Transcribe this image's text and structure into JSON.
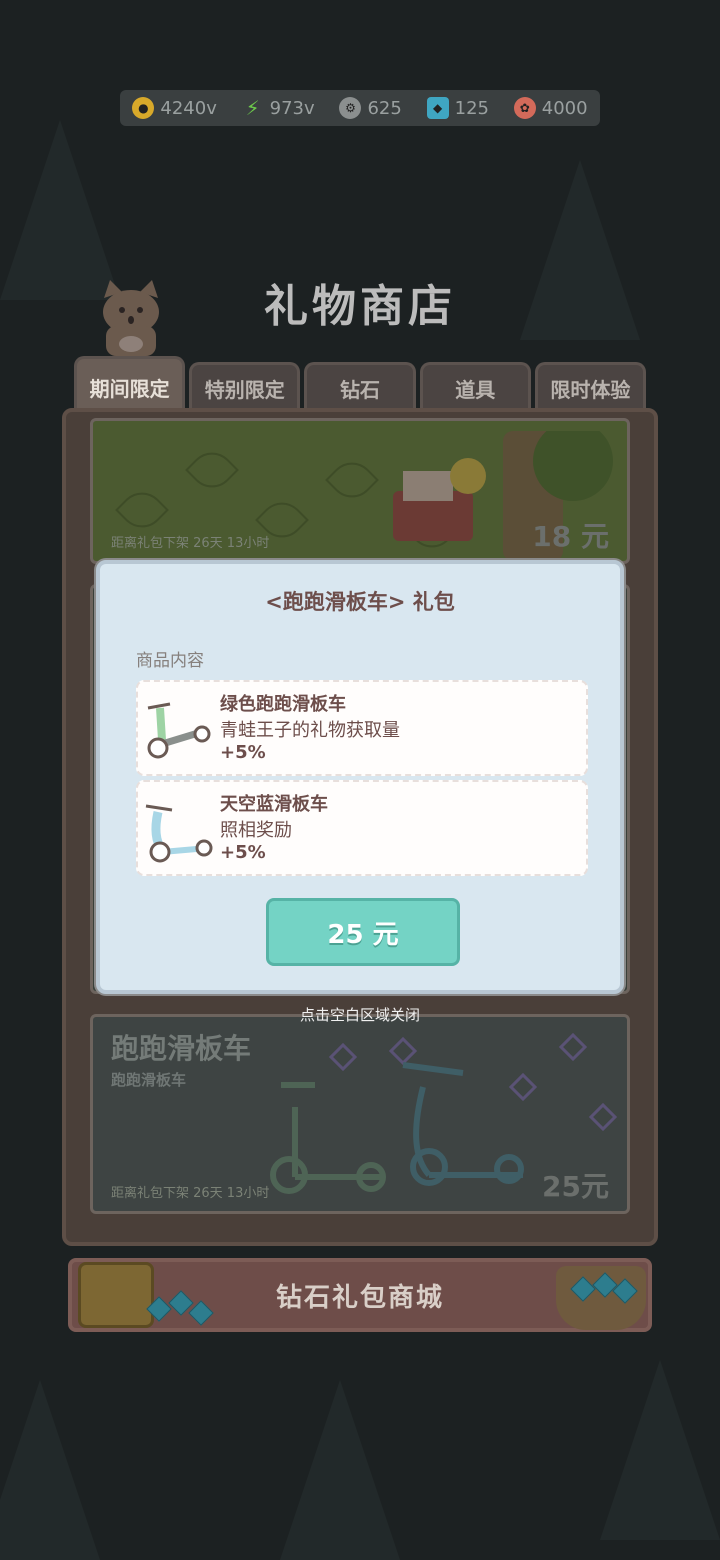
{
  "resources": [
    {
      "icon": "gold-coin-icon",
      "value": "4240v",
      "color": "#d8a92a"
    },
    {
      "icon": "energy-bolt-icon",
      "value": "973v",
      "color": "#6cc84b"
    },
    {
      "icon": "gear-token-icon",
      "value": "625",
      "color": "#8b8f8f"
    },
    {
      "icon": "blue-gem-icon",
      "value": "125",
      "color": "#3fa6c2"
    },
    {
      "icon": "red-ticket-icon",
      "value": "4000",
      "color": "#d36a5a"
    }
  ],
  "shop": {
    "title": "礼物商店"
  },
  "tabs": [
    "期间限定",
    "特别限定",
    "钻石",
    "道具",
    "限时体验"
  ],
  "card_top": {
    "timer": "距离礼包下架 26天 13小时",
    "price": "18 元"
  },
  "card_bottom": {
    "title": "跑跑滑板车",
    "subtitle": "跑跑滑板车",
    "timer": "距离礼包下架 26天 13小时",
    "price": "25元"
  },
  "modal": {
    "title": "<跑跑滑板车> 礼包",
    "contents_label": "商品内容",
    "items": [
      {
        "name": "绿色跑跑滑板车",
        "desc": "青蛙王子的礼物获取量",
        "bonus": "+5%"
      },
      {
        "name": "天空蓝滑板车",
        "desc": "照相奖励",
        "bonus": "+5%"
      }
    ],
    "buy_label": "25 元"
  },
  "close_hint": "点击空白区域关闭",
  "diamond_store": {
    "label": "钻石礼包商城"
  }
}
